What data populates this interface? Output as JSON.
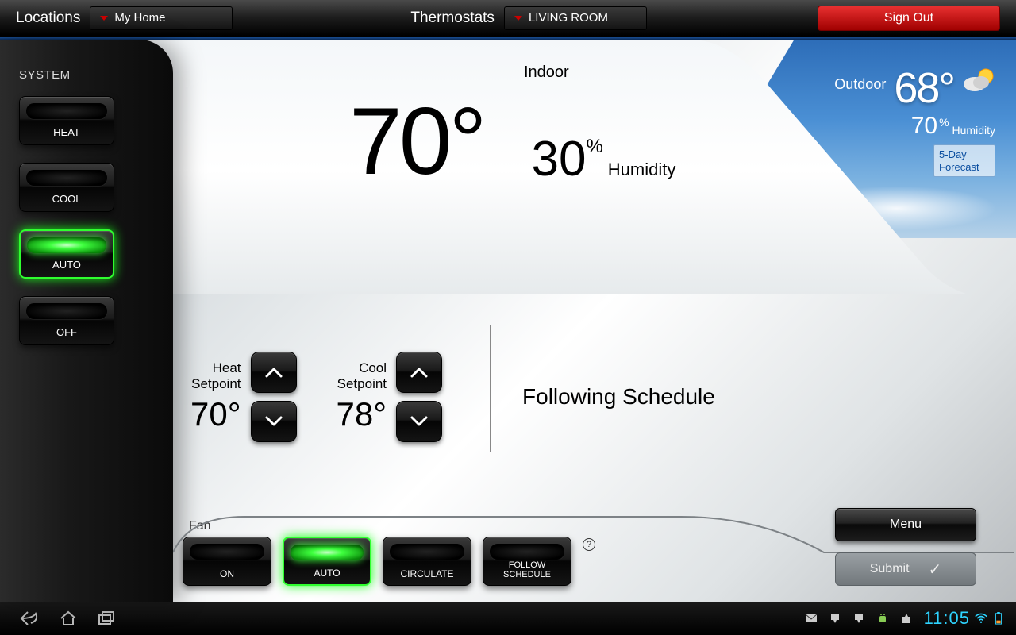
{
  "topbar": {
    "locations_label": "Locations",
    "location_value": "My Home",
    "thermostats_label": "Thermostats",
    "thermostat_value": "LIVING ROOM",
    "signout_label": "Sign Out"
  },
  "sidebar": {
    "title": "SYSTEM",
    "modes": [
      {
        "label": "HEAT",
        "active": false
      },
      {
        "label": "COOL",
        "active": false
      },
      {
        "label": "AUTO",
        "active": true
      },
      {
        "label": "OFF",
        "active": false
      }
    ]
  },
  "indoor": {
    "title": "Indoor",
    "temp": "70°",
    "humidity_value": "30",
    "humidity_pct": "%",
    "humidity_label": "Humidity"
  },
  "outdoor": {
    "title": "Outdoor",
    "temp": "68°",
    "humidity_value": "70",
    "humidity_pct": "%",
    "humidity_label": "Humidity",
    "forecast_label": "5-Day Forecast"
  },
  "setpoints": {
    "heat_label": "Heat\nSetpoint",
    "heat_value": "70°",
    "cool_label": "Cool\nSetpoint",
    "cool_value": "78°"
  },
  "status": {
    "text": "Following Schedule"
  },
  "fan": {
    "title": "Fan",
    "modes": [
      {
        "label": "ON",
        "active": false
      },
      {
        "label": "AUTO",
        "active": true
      },
      {
        "label": "CIRCULATE",
        "active": false
      },
      {
        "label": "FOLLOW\nSCHEDULE",
        "active": false
      }
    ]
  },
  "buttons": {
    "menu": "Menu",
    "submit": "Submit"
  },
  "navbar": {
    "clock": "11:05"
  }
}
